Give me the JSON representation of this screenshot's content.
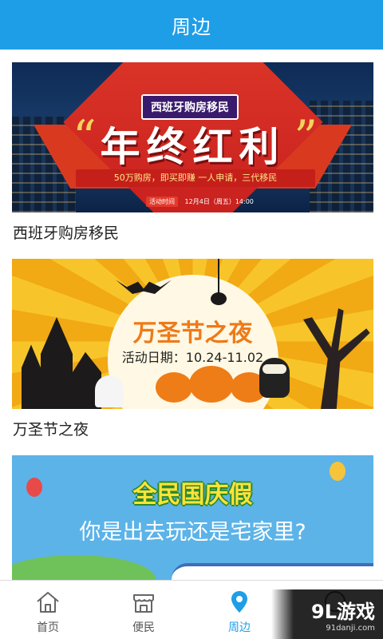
{
  "header": {
    "title": "周边"
  },
  "cards": [
    {
      "title": "西班牙购房移民",
      "banner": {
        "tag": "西班牙购房移民",
        "slogan": "年终红利",
        "open_quote": "“",
        "close_quote": "”",
        "strip": "50万购房，即买即赚 一人申请，三代移民",
        "foot_logo": "活动时间",
        "foot_time": "12月4日（周五）14:00"
      }
    },
    {
      "title": "万圣节之夜",
      "banner": {
        "title": "万圣节之夜",
        "date": "活动日期：10.24-11.02"
      }
    },
    {
      "title": "",
      "banner": {
        "line1": "全民国庆假",
        "line2": "你是出去玩还是宅家里?"
      }
    }
  ],
  "tabbar": {
    "tabs": [
      {
        "label": "首页",
        "icon": "home-icon",
        "active": false
      },
      {
        "label": "便民",
        "icon": "shop-icon",
        "active": false
      },
      {
        "label": "周边",
        "icon": "location-pin-icon",
        "active": true
      },
      {
        "label": "",
        "icon": "chat-icon",
        "active": false
      }
    ]
  },
  "watermark": {
    "main": "9L游戏",
    "sub": "91danji.com"
  },
  "colors": {
    "primary": "#1f9ee8",
    "text": "#222222",
    "tab_inactive": "#555555"
  }
}
